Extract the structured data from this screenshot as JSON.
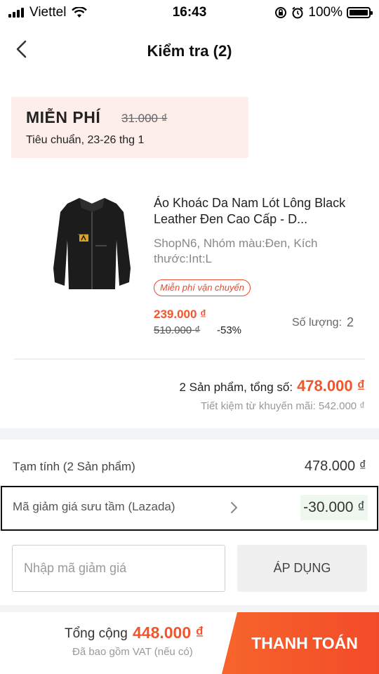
{
  "status_bar": {
    "carrier": "Viettel",
    "time": "16:43",
    "battery": "100%"
  },
  "header": {
    "title": "Kiểm tra (2)",
    "back_icon": "chevron-left-icon"
  },
  "shipping": {
    "free_label": "MIỄN PHÍ",
    "original_fee": "31.000 ₫",
    "detail": "Tiêu chuẩn, 23-26 thg 1"
  },
  "product": {
    "image_icon": "leather-jacket-image",
    "name": "Áo Khoác Da Nam Lót Lông Black Leather Đen Cao Cấp - D...",
    "variant": "ShopN6, Nhóm màu:Đen, Kích thước:Int:L",
    "badge": "Miễn phí vận chuyển",
    "price": "239.000 ₫",
    "original_price": "510.000 ₫",
    "discount": "-53%",
    "quantity_label": "Số lượng:",
    "quantity": "2"
  },
  "order_total": {
    "label": "2 Sản phẩm, tổng số:",
    "value": "478.000 ₫",
    "saving": "Tiết kiệm từ khuyến mãi: 542.000 ₫"
  },
  "summary": {
    "subtotal_label": "Tạm tính  (2 Sản phẩm)",
    "subtotal_value": "478.000 ₫",
    "voucher_label": "Mã giảm giá sưu tầm (Lazada)",
    "voucher_value": "-30.000 ₫"
  },
  "promo": {
    "placeholder": "Nhập mã giảm giá",
    "apply_label": "ÁP DỤNG"
  },
  "footer": {
    "grand_label": "Tổng cộng",
    "grand_value": "448.000 ₫",
    "vat_note": "Đã bao gồm VAT (nếu có)",
    "checkout_label": "THANH TOÁN"
  },
  "colors": {
    "accent": "#f0562d",
    "shipping_bg": "#fdeeea",
    "voucher_bg": "#eef8ef"
  }
}
